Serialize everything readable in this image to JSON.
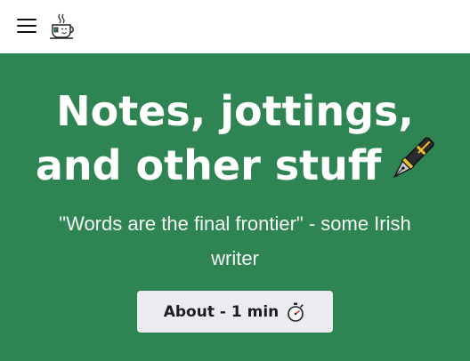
{
  "header": {
    "menu_icon": "hamburger-menu-icon",
    "logo_icon": "tea-cup-logo-icon"
  },
  "hero": {
    "title_line1": "Notes, jottings,",
    "title_line2": "and other stuff",
    "title_icon": "fountain-pen-icon",
    "quote": "\"Words are the final frontier\" - some Irish writer",
    "about_button_label": "About - 1 min",
    "about_button_icon": "stopwatch-icon"
  },
  "colors": {
    "hero_background": "#2e8553",
    "button_background": "#ececf0",
    "text_light": "#ffffff"
  }
}
